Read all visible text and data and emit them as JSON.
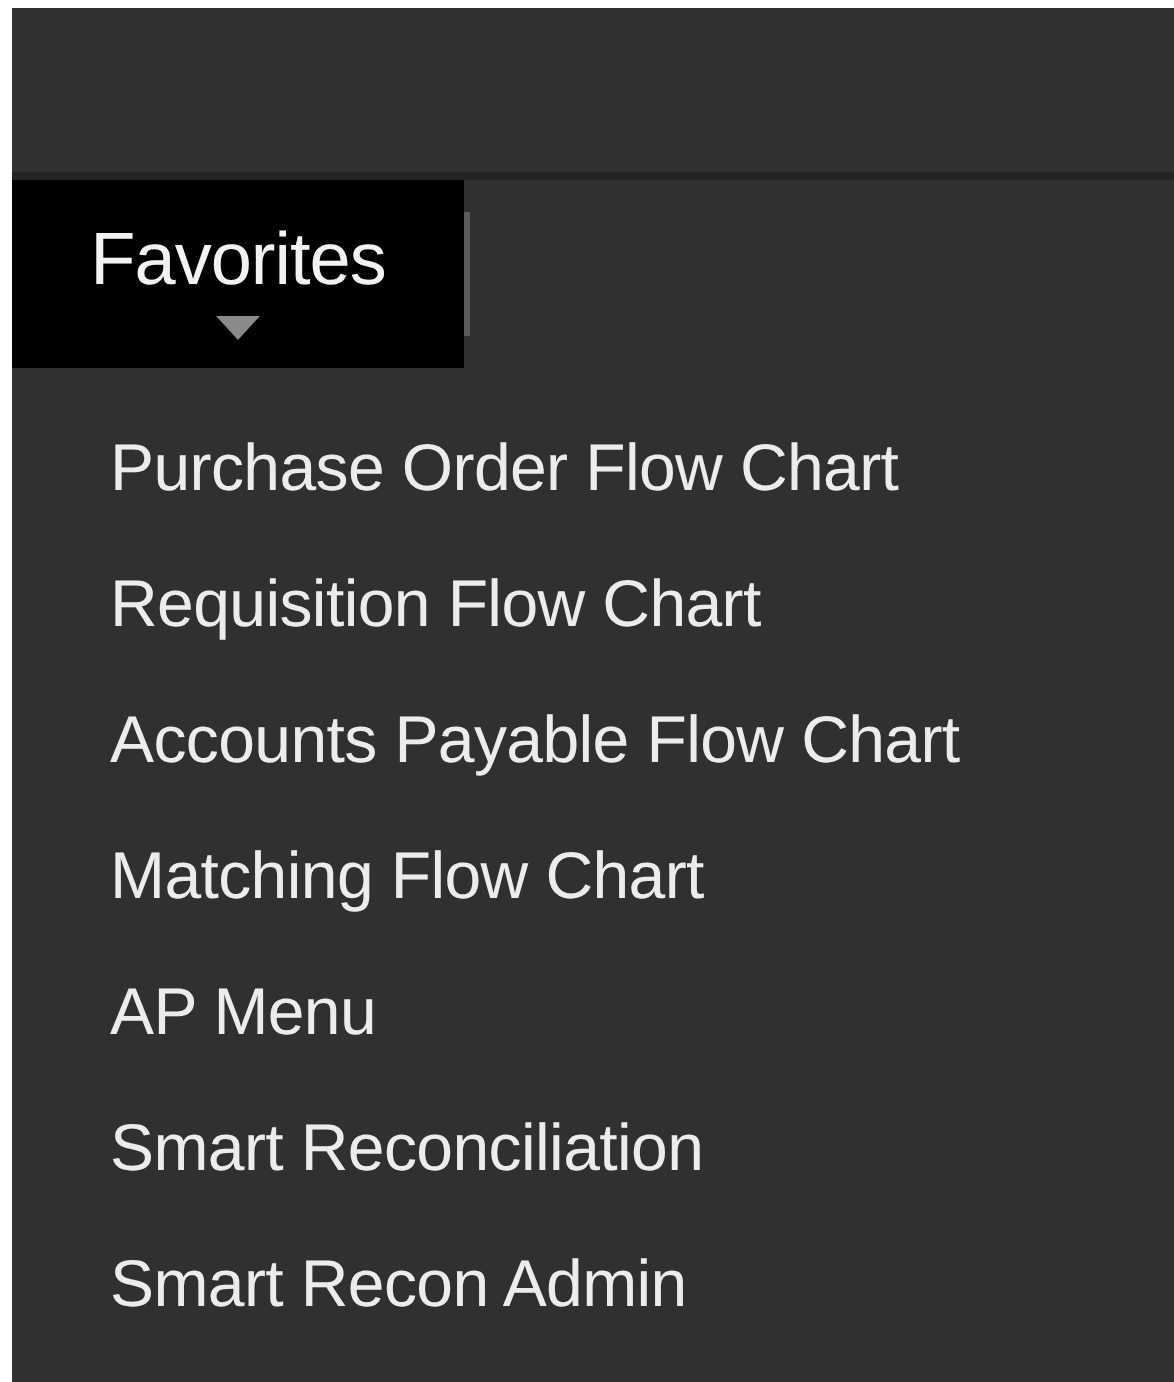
{
  "tab": {
    "label": "Favorites"
  },
  "menu_items": [
    {
      "label": "Purchase Order Flow Chart"
    },
    {
      "label": "Requisition Flow Chart"
    },
    {
      "label": "Accounts Payable Flow Chart"
    },
    {
      "label": "Matching Flow Chart"
    },
    {
      "label": "AP Menu"
    },
    {
      "label": "Smart Reconciliation"
    },
    {
      "label": "Smart Recon Admin"
    }
  ]
}
